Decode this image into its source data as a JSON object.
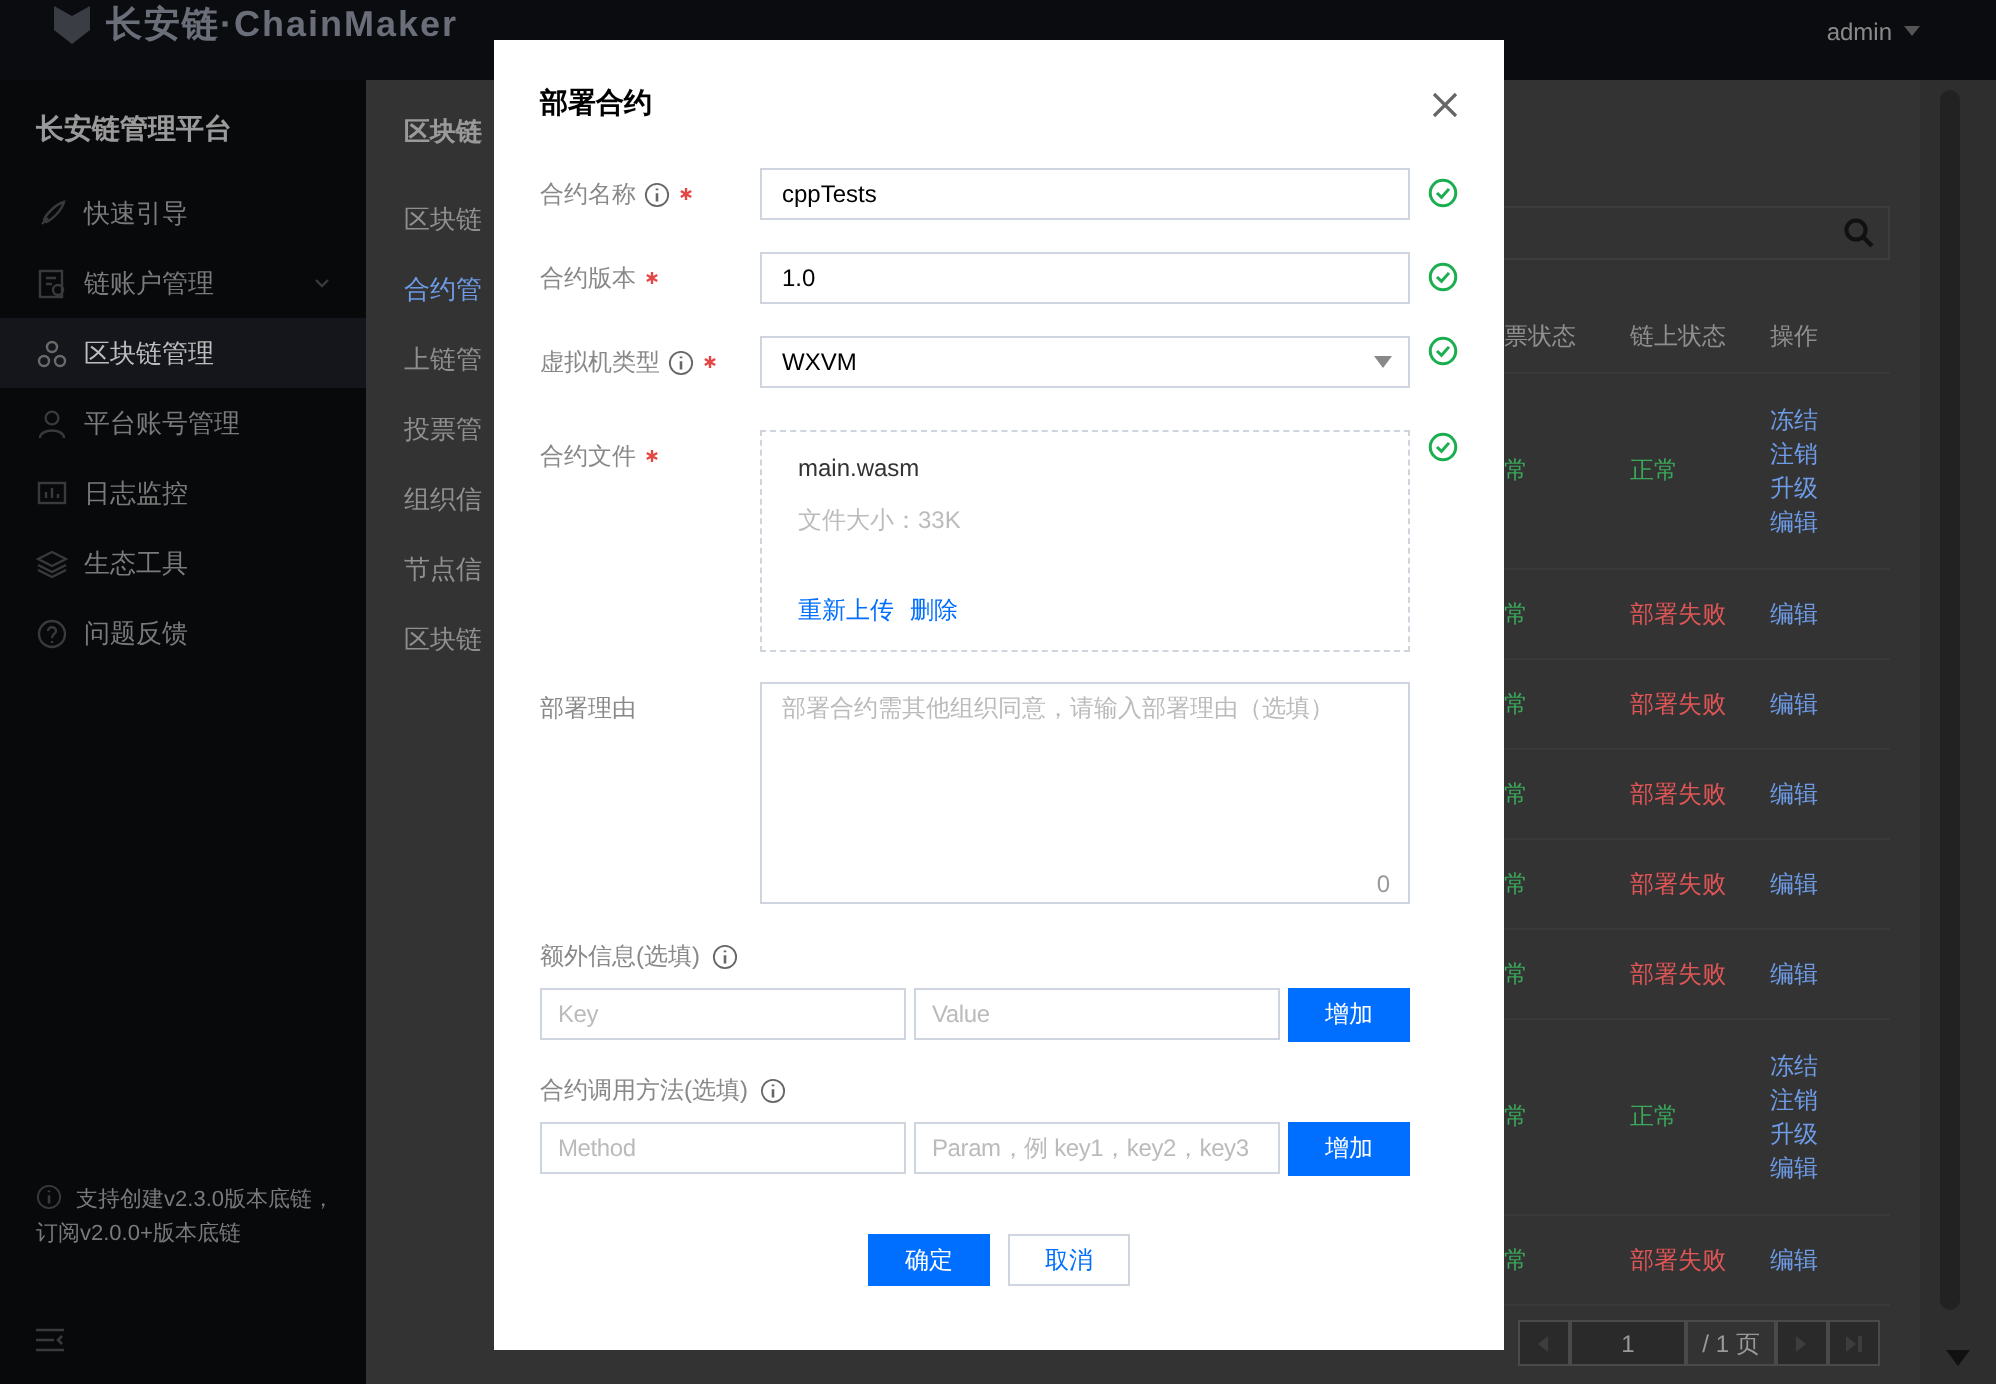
{
  "top_bar": {
    "logo": "长安链·ChainMaker",
    "user": "admin"
  },
  "sidebar": {
    "title": "长安链管理平台",
    "items": [
      {
        "label": "快速引导",
        "selected": false
      },
      {
        "label": "链账户管理",
        "selected": false,
        "submenu": true
      },
      {
        "label": "区块链管理",
        "selected": true
      },
      {
        "label": "平台账号管理",
        "selected": false
      },
      {
        "label": "日志监控",
        "selected": false
      },
      {
        "label": "生态工具",
        "selected": false
      },
      {
        "label": "问题反馈",
        "selected": false
      }
    ],
    "notice": "支持创建v2.3.0版本底链，订阅v2.0.0+版本底链"
  },
  "subnav": {
    "title": "区块链",
    "items": [
      {
        "label": "区块链",
        "selected": false
      },
      {
        "label": "合约管",
        "selected": true
      },
      {
        "label": "上链管",
        "selected": false
      },
      {
        "label": "投票管",
        "selected": false
      },
      {
        "label": "组织信",
        "selected": false
      },
      {
        "label": "节点信",
        "selected": false
      },
      {
        "label": "区块链",
        "selected": false
      }
    ]
  },
  "table": {
    "columns": [
      "票状态",
      "链上状态",
      "操作"
    ],
    "rows": [
      {
        "vote_state": {
          "text": "常",
          "color": "#3aa85a"
        },
        "chain_state": {
          "text": "正常",
          "color": "#3aa85a"
        },
        "actions": [
          "冻结",
          "注销",
          "升级",
          "编辑"
        ]
      },
      {
        "vote_state": {
          "text": "常",
          "color": "#3aa85a"
        },
        "chain_state": {
          "text": "部署失败",
          "color": "#e05555"
        },
        "actions": [
          "编辑"
        ]
      },
      {
        "vote_state": {
          "text": "常",
          "color": "#3aa85a"
        },
        "chain_state": {
          "text": "部署失败",
          "color": "#e05555"
        },
        "actions": [
          "编辑"
        ]
      },
      {
        "vote_state": {
          "text": "常",
          "color": "#3aa85a"
        },
        "chain_state": {
          "text": "部署失败",
          "color": "#e05555"
        },
        "actions": [
          "编辑"
        ]
      },
      {
        "vote_state": {
          "text": "常",
          "color": "#3aa85a"
        },
        "chain_state": {
          "text": "部署失败",
          "color": "#e05555"
        },
        "actions": [
          "编辑"
        ]
      },
      {
        "vote_state": {
          "text": "常",
          "color": "#3aa85a"
        },
        "chain_state": {
          "text": "部署失败",
          "color": "#e05555"
        },
        "actions": [
          "编辑"
        ]
      },
      {
        "vote_state": {
          "text": "常",
          "color": "#3aa85a"
        },
        "chain_state": {
          "text": "正常",
          "color": "#3aa85a"
        },
        "actions": [
          "冻结",
          "注销",
          "升级",
          "编辑"
        ]
      },
      {
        "vote_state": {
          "text": "常",
          "color": "#3aa85a"
        },
        "chain_state": {
          "text": "部署失败",
          "color": "#e05555"
        },
        "actions": [
          "编辑"
        ]
      }
    ],
    "pagination": {
      "page": "1",
      "total": "/ 1 页"
    }
  },
  "modal": {
    "title": "部署合约",
    "fields": [
      {
        "kind": "input",
        "label": "合约名称",
        "info": true,
        "required": true,
        "valid": true,
        "value": "cppTests"
      },
      {
        "kind": "input",
        "label": "合约版本",
        "required": true,
        "valid": true,
        "value": "1.0"
      },
      {
        "kind": "select",
        "label": "虚拟机类型",
        "info": true,
        "required": true,
        "valid": true,
        "value": "WXVM"
      },
      {
        "kind": "file",
        "label": "合约文件",
        "required": true,
        "valid": true,
        "file_name": "main.wasm",
        "file_size": "文件大小：33K",
        "actions": [
          "重新上传",
          "删除"
        ]
      },
      {
        "kind": "textarea",
        "label": "部署理由",
        "placeholder": "部署合约需其他组织同意，请输入部署理由（选填）",
        "count": "0"
      }
    ],
    "pairs": [
      {
        "label": "额外信息(选填)",
        "placeholders": [
          "Key",
          "Value"
        ],
        "button": "增加"
      },
      {
        "label": "合约调用方法(选填)",
        "placeholders": [
          "Method",
          "Param，例 key1，key2，key3"
        ],
        "button": "增加"
      }
    ],
    "buttons": [
      {
        "label": "确定",
        "kind": "primary"
      },
      {
        "label": "取消",
        "kind": "secondary"
      }
    ]
  }
}
